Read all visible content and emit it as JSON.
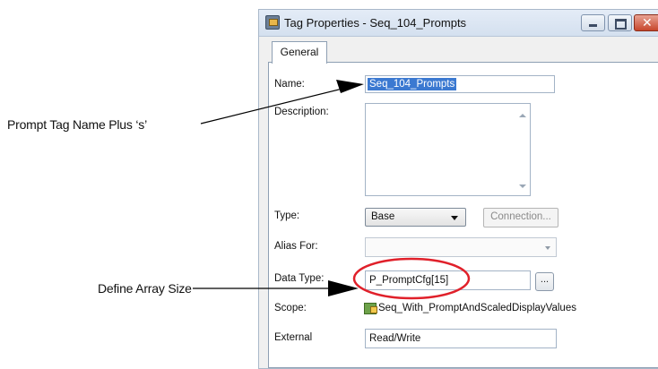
{
  "callouts": {
    "name": "Prompt Tag Name Plus ‘s’",
    "array": "Define Array Size"
  },
  "window": {
    "title": "Tag Properties - Seq_104_Prompts"
  },
  "tabs": [
    {
      "label": "General",
      "selected": true
    }
  ],
  "form": {
    "name_label": "Name:",
    "name_value": "Seq_104_Prompts",
    "description_label": "Description:",
    "description_value": "",
    "type_label": "Type:",
    "type_value": "Base",
    "connection_label": "Connection...",
    "alias_label": "Alias For:",
    "alias_value": "",
    "datatype_label": "Data Type:",
    "datatype_value": "P_PromptCfg[15]",
    "browse_label": "...",
    "scope_label": "Scope:",
    "scope_value": "Seq_With_PromptAndScaledDisplayValues",
    "external_label": "External",
    "external_value": "Read/Write"
  },
  "icons": {
    "app": "tag-properties-icon",
    "scope": "program-scope-icon",
    "minimize": "minimize-icon",
    "maximize": "maximize-icon",
    "close": "close-icon"
  },
  "colors": {
    "selection": "#3b79d1",
    "highlight_ellipse": "#e0202a",
    "close_button": "#c7462c"
  }
}
